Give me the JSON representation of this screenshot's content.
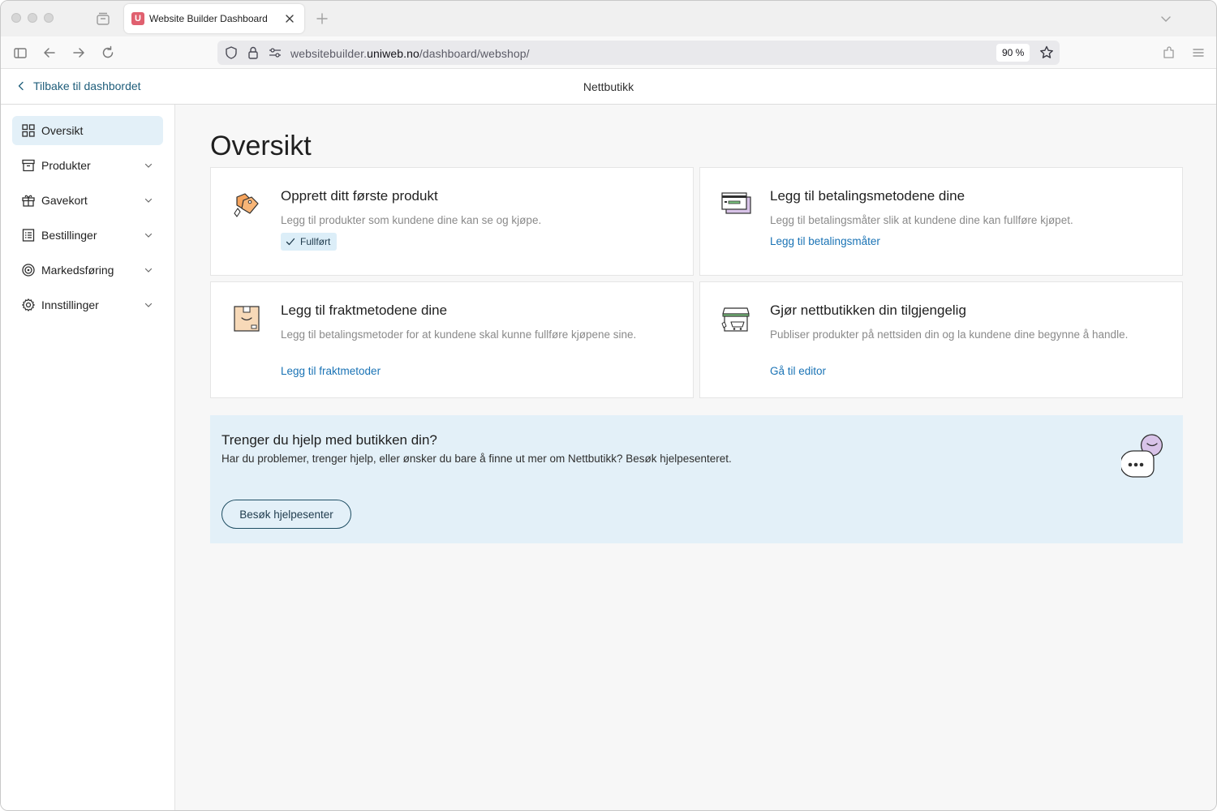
{
  "browser": {
    "tab_title": "Website Builder Dashboard",
    "favicon_letter": "U",
    "url_prefix": "websitebuilder.",
    "url_domain": "uniweb.no",
    "url_path": "/dashboard/webshop/",
    "zoom": "90 %"
  },
  "header": {
    "back_label": "Tilbake til dashbordet",
    "title": "Nettbutikk"
  },
  "sidebar": {
    "items": [
      {
        "label": "Oversikt",
        "icon": "grid-icon",
        "active": true
      },
      {
        "label": "Produkter",
        "icon": "box-icon"
      },
      {
        "label": "Gavekort",
        "icon": "gift-icon"
      },
      {
        "label": "Bestillinger",
        "icon": "list-icon"
      },
      {
        "label": "Markedsføring",
        "icon": "target-icon"
      },
      {
        "label": "Innstillinger",
        "icon": "gear-icon"
      }
    ]
  },
  "main": {
    "title": "Oversikt",
    "cards": [
      {
        "title": "Opprett ditt første produkt",
        "desc": "Legg til produkter som kundene dine kan se og kjøpe.",
        "badge": "Fullført",
        "icon": "price-tag-icon"
      },
      {
        "title": "Legg til betalingsmetodene dine",
        "desc": "Legg til betalingsmåter slik at kundene dine kan fullføre kjøpet.",
        "link": "Legg til betalingsmåter",
        "icon": "credit-card-icon"
      },
      {
        "title": "Legg til fraktmetodene dine",
        "desc": "Legg til betalingsmetoder for at kundene skal kunne fullføre kjøpene sine.",
        "link": "Legg til fraktmetoder",
        "icon": "package-icon"
      },
      {
        "title": "Gjør nettbutikken din tilgjengelig",
        "desc": "Publiser produkter på nettsiden din og la kundene dine begynne å handle.",
        "link": "Gå til editor",
        "icon": "storefront-icon"
      }
    ],
    "help": {
      "title": "Trenger du hjelp med butikken din?",
      "desc": "Har du problemer, trenger hjelp, eller ønsker du bare å finne ut mer om Nettbutikk? Besøk hjelpesenteret.",
      "button": "Besøk hjelpesenter",
      "icon": "chat-bubbles-icon"
    }
  },
  "colors": {
    "accent_link": "#1a73b5",
    "active_bg": "#e3f0f8",
    "help_bg": "#e3f0f8"
  }
}
